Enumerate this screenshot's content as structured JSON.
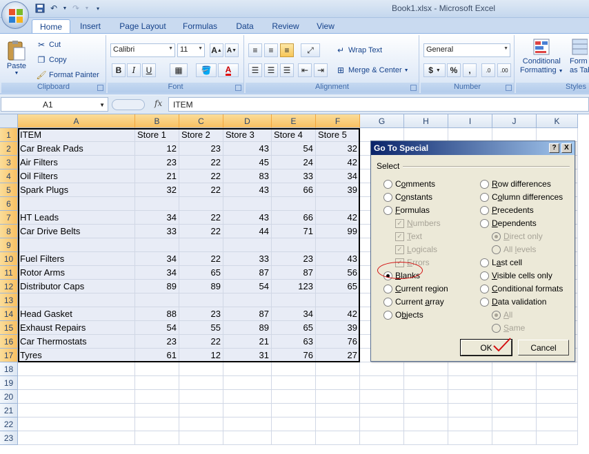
{
  "window": {
    "title": "Book1.xlsx - Microsoft Excel"
  },
  "tabs": [
    "Home",
    "Insert",
    "Page Layout",
    "Formulas",
    "Data",
    "Review",
    "View"
  ],
  "ribbon": {
    "clipboard": {
      "label": "Clipboard",
      "paste": "Paste",
      "cut": "Cut",
      "copy": "Copy",
      "format_painter": "Format Painter"
    },
    "font": {
      "label": "Font",
      "family": "Calibri",
      "size": "11",
      "grow": "A",
      "shrink": "A",
      "bold": "B",
      "italic": "I",
      "underline": "U",
      "font_color": "A"
    },
    "alignment": {
      "label": "Alignment",
      "wrap_text": "Wrap Text",
      "merge_center": "Merge & Center"
    },
    "number": {
      "label": "Number",
      "format": "General",
      "currency": "$",
      "percent": "%",
      "comma": ",",
      "inc_decimal": ".0",
      "dec_decimal": ".00"
    },
    "styles": {
      "label": "Styles",
      "conditional_1": "Conditional",
      "conditional_2": "Formatting",
      "format_table_1": "Form",
      "format_table_2": "as Tab"
    }
  },
  "formula_bar": {
    "name_box": "A1",
    "fx": "fx",
    "value": "ITEM"
  },
  "columns": [
    "A",
    "B",
    "C",
    "D",
    "E",
    "F",
    "G",
    "H",
    "I",
    "J",
    "K"
  ],
  "rows": [
    "1",
    "2",
    "3",
    "4",
    "5",
    "6",
    "7",
    "8",
    "9",
    "10",
    "11",
    "12",
    "13",
    "14",
    "15",
    "16",
    "17",
    "18",
    "19",
    "20",
    "21",
    "22",
    "23"
  ],
  "table": [
    [
      "ITEM",
      "Store 1",
      "Store 2",
      "Store 3",
      "Store 4",
      "Store 5"
    ],
    [
      "Car Break Pads",
      "12",
      "23",
      "43",
      "54",
      "32"
    ],
    [
      "Air Filters",
      "23",
      "22",
      "45",
      "24",
      "42"
    ],
    [
      "Oil Filters",
      "21",
      "22",
      "83",
      "33",
      "34"
    ],
    [
      "Spark Plugs",
      "32",
      "22",
      "43",
      "66",
      "39"
    ],
    [
      "",
      "",
      "",
      "",
      "",
      ""
    ],
    [
      "HT Leads",
      "34",
      "22",
      "43",
      "66",
      "42"
    ],
    [
      "Car Drive Belts",
      "33",
      "22",
      "44",
      "71",
      "99"
    ],
    [
      "",
      "",
      "",
      "",
      "",
      ""
    ],
    [
      "Fuel Filters",
      "34",
      "22",
      "33",
      "23",
      "43"
    ],
    [
      "Rotor Arms",
      "34",
      "65",
      "87",
      "87",
      "56"
    ],
    [
      "Distributor Caps",
      "89",
      "89",
      "54",
      "123",
      "65"
    ],
    [
      "",
      "",
      "",
      "",
      "",
      ""
    ],
    [
      "Head Gasket",
      "88",
      "23",
      "87",
      "34",
      "42"
    ],
    [
      "Exhaust Repairs",
      "54",
      "55",
      "89",
      "65",
      "39"
    ],
    [
      "Car Thermostats",
      "23",
      "22",
      "21",
      "63",
      "76"
    ],
    [
      "Tyres",
      "61",
      "12",
      "31",
      "76",
      "27"
    ]
  ],
  "dialog": {
    "title": "Go To Special",
    "help": "?",
    "close": "X",
    "select_label": "Select",
    "left_options": [
      {
        "label": "Comments",
        "state": "off"
      },
      {
        "label": "Constants",
        "state": "off"
      },
      {
        "label": "Formulas",
        "state": "off"
      },
      {
        "label": "Numbers",
        "state": "checkbox-disabled"
      },
      {
        "label": "Text",
        "state": "checkbox-disabled"
      },
      {
        "label": "Logicals",
        "state": "checkbox-disabled"
      },
      {
        "label": "Errors",
        "state": "checkbox-disabled"
      },
      {
        "label": "Blanks",
        "state": "on"
      },
      {
        "label": "Current region",
        "state": "off"
      },
      {
        "label": "Current array",
        "state": "off"
      },
      {
        "label": "Objects",
        "state": "off"
      }
    ],
    "right_options": [
      {
        "label": "Row differences",
        "state": "off"
      },
      {
        "label": "Column differences",
        "state": "off"
      },
      {
        "label": "Precedents",
        "state": "off"
      },
      {
        "label": "Dependents",
        "state": "off"
      },
      {
        "label": "Direct only",
        "state": "disabled-on"
      },
      {
        "label": "All levels",
        "state": "disabled"
      },
      {
        "label": "Last cell",
        "state": "off"
      },
      {
        "label": "Visible cells only",
        "state": "off"
      },
      {
        "label": "Conditional formats",
        "state": "off"
      },
      {
        "label": "Data validation",
        "state": "off"
      },
      {
        "label": "All",
        "state": "disabled-on"
      },
      {
        "label": "Same",
        "state": "disabled"
      }
    ],
    "ok": "OK",
    "cancel": "Cancel"
  },
  "colors": {
    "annotation": "#d41010",
    "header_selected": "#f8c062",
    "ribbon_bg": "#dfe9f5",
    "dialog_bg": "#ece9d8"
  }
}
